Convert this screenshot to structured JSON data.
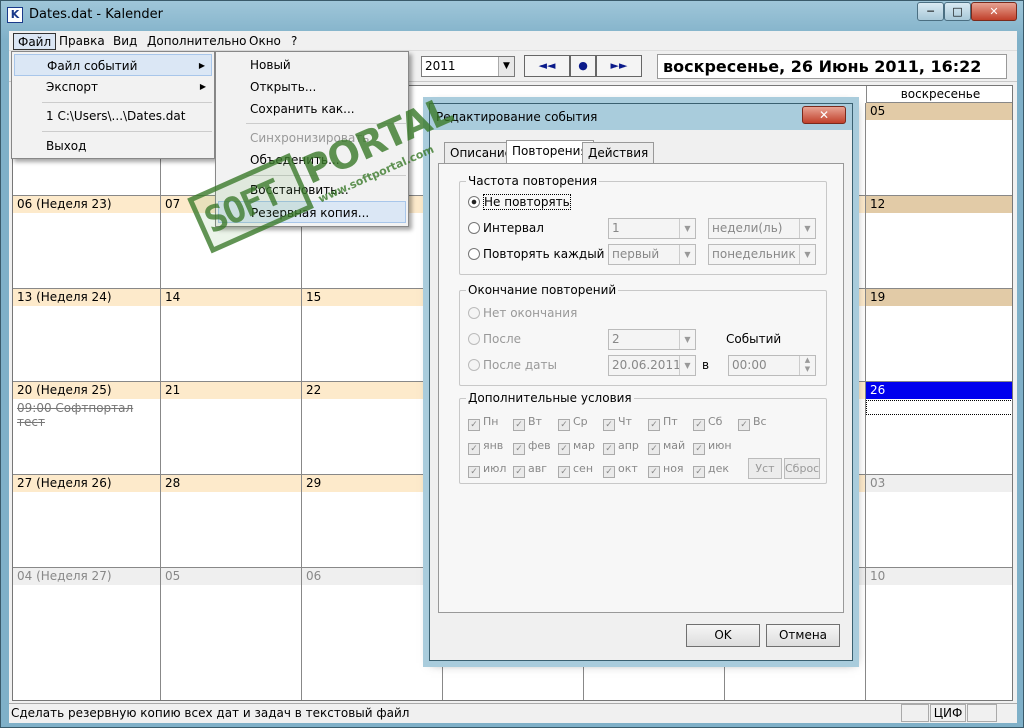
{
  "window": {
    "title": "Dates.dat - Kalender",
    "min": "─",
    "max": "□",
    "close": "✕"
  },
  "menubar": [
    "Файл",
    "Правка",
    "Вид",
    "Дополнительно",
    "Окно",
    "?"
  ],
  "toolbar": {
    "year": "2011",
    "prev": "◄◄",
    "today": "●",
    "next": "►►",
    "date_heading": "воскресенье, 26 Июнь 2011, 16:22"
  },
  "file_menu": {
    "items": [
      "Файл событий",
      "Экспорт",
      "1 C:\\Users\\...\\Dates.dat",
      "Выход"
    ],
    "submenu_arrow": "▶"
  },
  "submenu": {
    "items": [
      "Новый",
      "Открыть...",
      "Сохранить как...",
      "Синхронизировать",
      "Объеденить...",
      "Восстановить...",
      "Резервная копия..."
    ],
    "disabled_index": 3,
    "highlighted_index": 6
  },
  "calendar": {
    "day_names": [
      "",
      "",
      "",
      "",
      "",
      "",
      "воскресенье"
    ],
    "rows": [
      {
        "labels": [
          "",
          "",
          "",
          "",
          "",
          "",
          "05"
        ],
        "kinds": [
          "week",
          "plain",
          "plain",
          "plain",
          "plain",
          "plain",
          "weekend"
        ]
      },
      {
        "labels": [
          "06 (Неделя 23)",
          "07",
          "",
          "",
          "",
          "",
          "12"
        ],
        "kinds": [
          "week",
          "week",
          "week",
          "week",
          "week",
          "week",
          "weekend"
        ]
      },
      {
        "labels": [
          "13 (Неделя 24)",
          "14",
          "15",
          "",
          "",
          "",
          "19"
        ],
        "kinds": [
          "week",
          "week",
          "week",
          "week",
          "week",
          "week",
          "weekend"
        ]
      },
      {
        "labels": [
          "20 (Неделя 25)",
          "21",
          "22",
          "",
          "",
          "",
          "26"
        ],
        "kinds": [
          "week",
          "week",
          "week",
          "week",
          "week",
          "week",
          "today"
        ]
      },
      {
        "labels": [
          "27 (Неделя 26)",
          "28",
          "29",
          "",
          "",
          "",
          "03"
        ],
        "kinds": [
          "week",
          "week",
          "week",
          "week",
          "week",
          "week",
          "next"
        ]
      },
      {
        "labels": [
          "04 (Неделя 27)",
          "05",
          "06",
          "",
          "",
          "",
          "10"
        ],
        "kinds": [
          "next",
          "next",
          "next",
          "next",
          "next",
          "next",
          "next"
        ]
      }
    ],
    "event": "09:00 Софтпортал тест"
  },
  "status": {
    "text": "Сделать резервную копию всех дат и задач в текстовый файл",
    "panel": "ЦИФ"
  },
  "dialog": {
    "title": "Редактирование события",
    "close": "✕",
    "tabs": [
      "Описание",
      "Повторения",
      "Действия"
    ],
    "freq_group": "Частота повторения",
    "radio_no_repeat": "Не повторять",
    "radio_interval": "Интервал",
    "radio_repeat_each": "Повторять каждый",
    "interval_value": "1",
    "interval_unit": "недели(ль)",
    "each_which": "первый",
    "each_day": "понедельник",
    "end_group": "Окончание повторений",
    "radio_no_end": "Нет окончания",
    "radio_after": "После",
    "after_value": "2",
    "events_label": "Событий",
    "radio_after_date": "После даты",
    "after_date": "20.06.2011",
    "in_label": "в",
    "time_value": "00:00",
    "extra_group": "Дополнительные условия",
    "days": [
      "Пн",
      "Вт",
      "Ср",
      "Чт",
      "Пт",
      "Сб",
      "Вс"
    ],
    "months1": [
      "янв",
      "фев",
      "мар",
      "апр",
      "май",
      "июн"
    ],
    "months2": [
      "июл",
      "авг",
      "сен",
      "окт",
      "ноя",
      "дек"
    ],
    "btn_set": "Уст",
    "btn_reset": "Сброс",
    "ok": "OK",
    "cancel": "Отмена"
  },
  "watermark": {
    "soft": "SOFT",
    "portal": "PORTAL",
    "url": "www.softportal.com"
  }
}
